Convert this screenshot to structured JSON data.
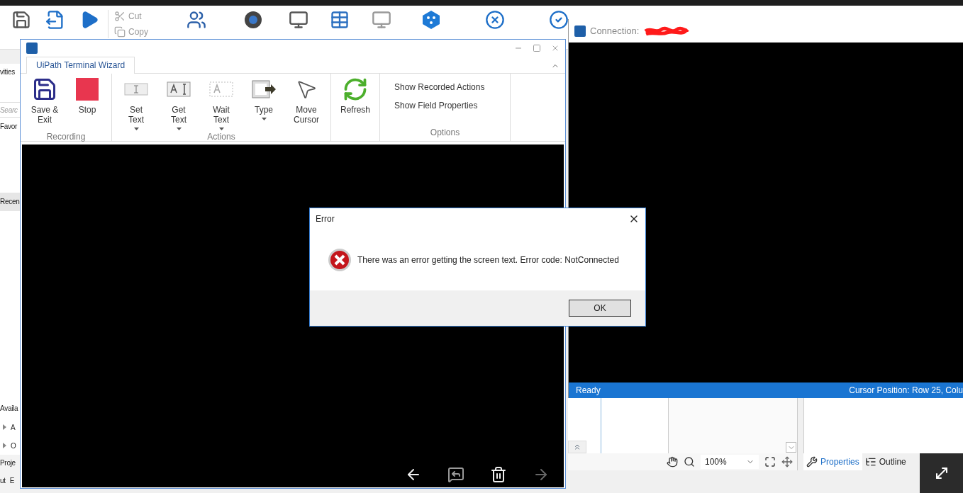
{
  "studio": {
    "clipboard": [
      "Cut",
      "Copy"
    ],
    "sidebar": {
      "title": "vities",
      "search_placeholder": "Searc",
      "sections": [
        {
          "label": "Favor",
          "selected": false
        },
        {
          "label": "Recen",
          "selected": true
        },
        {
          "label": "Availa",
          "selected": false
        }
      ],
      "tree": [
        "A",
        "O"
      ],
      "bottom_tabs": [
        "Proje",
        "ut",
        "E"
      ]
    }
  },
  "wizard": {
    "tab": "UiPath Terminal Wizard",
    "groups": [
      {
        "label": "Recording",
        "buttons": [
          {
            "label": "Save &\nExit",
            "dropdown": false
          },
          {
            "label": "Stop",
            "dropdown": false
          }
        ]
      },
      {
        "label": "Actions",
        "buttons": [
          {
            "label": "Set\nText",
            "dropdown": true
          },
          {
            "label": "Get\nText",
            "dropdown": true
          },
          {
            "label": "Wait\nText",
            "dropdown": true
          },
          {
            "label": "Type",
            "dropdown": true
          },
          {
            "label": "Move\nCursor",
            "dropdown": false
          }
        ]
      },
      {
        "buttons": [
          {
            "label": "Refresh",
            "dropdown": false
          }
        ]
      }
    ],
    "options": {
      "label": "Options",
      "items": [
        "Show Recorded Actions",
        "Show Field Properties"
      ]
    },
    "terminal_nav": [
      {
        "disabled": false
      },
      {
        "disabled": false
      },
      {
        "disabled": false
      },
      {
        "disabled": true
      }
    ]
  },
  "connection": {
    "title": "Connection:",
    "status_left": "Ready",
    "status_right": "Cursor Position: Row 25, Colu"
  },
  "designer": {
    "zoom": "100%",
    "tabs": [
      {
        "label": "Properties",
        "selected": true
      },
      {
        "label": "Outline",
        "selected": false
      }
    ]
  },
  "dialog": {
    "title": "Error",
    "message": "There was an error getting the screen text. Error code: NotConnected",
    "button": "OK"
  }
}
